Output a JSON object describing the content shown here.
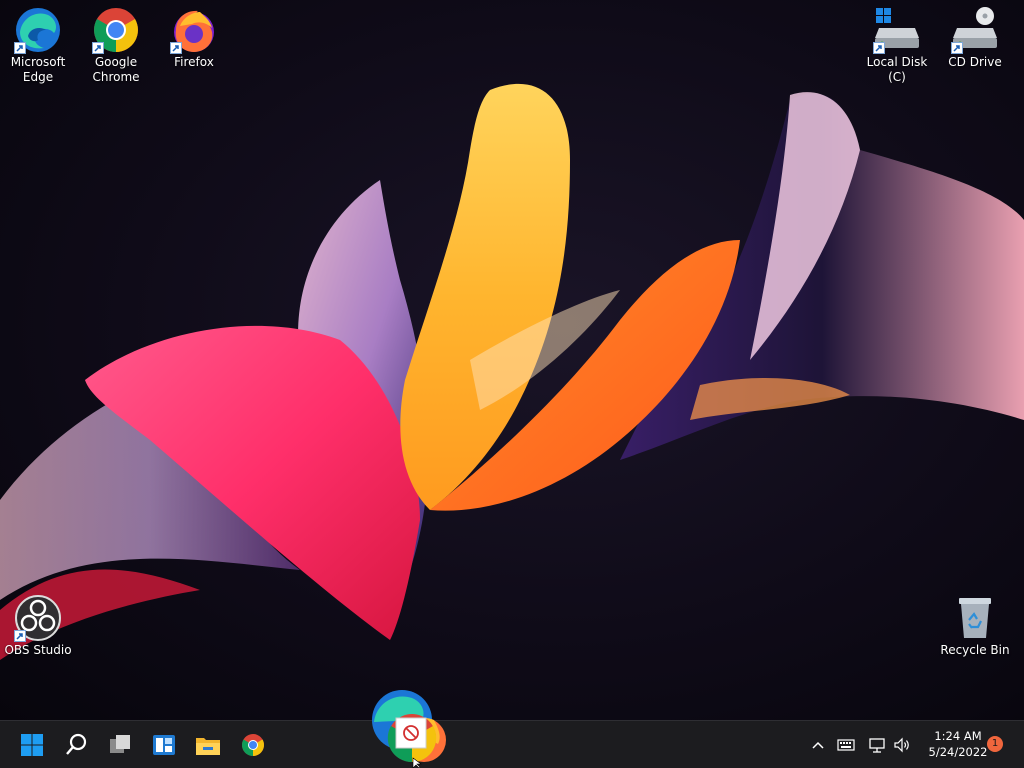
{
  "desktop": {
    "icons": [
      {
        "id": "edge",
        "label_line1": "Microsoft",
        "label_line2": "Edge",
        "icon": "edge-icon",
        "shortcut": true
      },
      {
        "id": "chrome",
        "label_line1": "Google",
        "label_line2": "Chrome",
        "icon": "chrome-icon",
        "shortcut": true
      },
      {
        "id": "firefox",
        "label_line1": "Firefox",
        "label_line2": "",
        "icon": "firefox-icon",
        "shortcut": true
      },
      {
        "id": "localdisk",
        "label_line1": "Local Disk (C)",
        "label_line2": "",
        "icon": "hard-drive-icon",
        "shortcut": true
      },
      {
        "id": "cddrive",
        "label_line1": "CD Drive",
        "label_line2": "",
        "icon": "cd-drive-icon",
        "shortcut": true
      },
      {
        "id": "obs",
        "label_line1": "OBS Studio",
        "label_line2": "",
        "icon": "obs-studio-icon",
        "shortcut": true
      },
      {
        "id": "recycle",
        "label_line1": "Recycle Bin",
        "label_line2": "",
        "icon": "recycle-bin-icon",
        "shortcut": false
      }
    ]
  },
  "taskbar": {
    "pinned": [
      {
        "id": "start",
        "icon": "windows-start-icon"
      },
      {
        "id": "search",
        "icon": "search-icon"
      },
      {
        "id": "task-view",
        "icon": "task-view-icon"
      },
      {
        "id": "widgets",
        "icon": "widgets-icon"
      },
      {
        "id": "file-explorer",
        "icon": "folder-icon"
      },
      {
        "id": "chrome",
        "icon": "chrome-icon"
      }
    ],
    "tray": {
      "icons": [
        "chevron-up-icon",
        "keyboard-icon",
        "network-icon",
        "speaker-icon"
      ],
      "time": "1:24 AM",
      "date": "5/24/2022",
      "notification_count": "1"
    },
    "drag_feedback": {
      "icon": "no-drop-icon",
      "dragged_items": [
        "edge-icon",
        "chrome-icon",
        "firefox-icon"
      ]
    }
  },
  "colors": {
    "taskbar_bg": "#1c1c1f",
    "accent_blue": "#0078d4",
    "badge": "#f0663d",
    "wallpaper_bg": "#0f0b18"
  }
}
